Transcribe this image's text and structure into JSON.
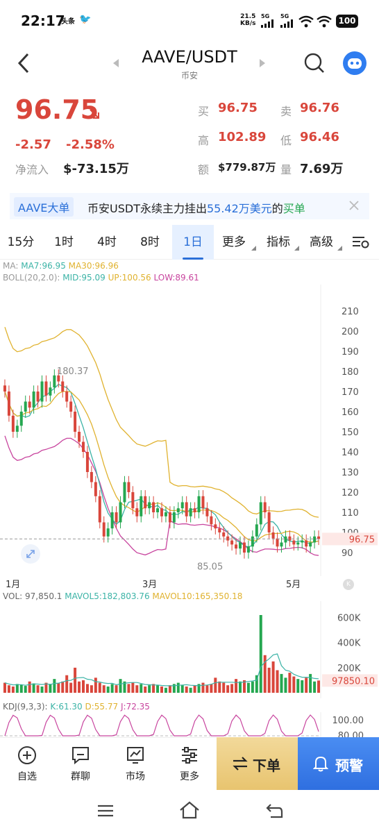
{
  "status_bar": {
    "time": "22:17",
    "app_icons": "头条",
    "net_speed_top": "21.5",
    "net_speed_bottom": "KB/s",
    "sig1": "5G",
    "sig2": "5G",
    "battery": "100"
  },
  "header": {
    "title": "AAVE/USDT",
    "subtitle": "币安"
  },
  "ticker": {
    "price": "96.75",
    "change": "-2.57",
    "change_pct": "-2.58%",
    "netflow_label": "净流入",
    "netflow": "$-73.15万",
    "bid_label": "买",
    "bid": "96.75",
    "ask_label": "卖",
    "ask": "96.76",
    "high_label": "高",
    "high": "102.89",
    "low_label": "低",
    "low": "96.46",
    "amount_label": "额",
    "amount": "$779.87万",
    "volume_label": "量",
    "volume": "7.69万"
  },
  "banner": {
    "tag": "AAVE大单",
    "text1": "币安USDT永续主力挂出",
    "amount": "55.42万美元",
    "text2": "的",
    "side": "买单"
  },
  "tabs": [
    {
      "label": "15分"
    },
    {
      "label": "1时"
    },
    {
      "label": "4时"
    },
    {
      "label": "8时"
    },
    {
      "label": "1日"
    },
    {
      "label": "更多"
    },
    {
      "label": "指标"
    },
    {
      "label": "高级"
    }
  ],
  "indicators": {
    "ma_label": "MA:",
    "ma7": "MA7:96.95",
    "ma30": "MA30:96.96",
    "boll_label": "BOLL(20,2.0):",
    "boll_mid": "MID:95.09",
    "boll_up": "UP:100.56",
    "boll_low": "LOW:89.61",
    "vol_label": "VOL: 97,850.1",
    "mavol5": "MAVOL5:182,803.76",
    "mavol10": "MAVOL10:165,350.18",
    "kdj_label": "KDJ(9,3,3):",
    "kdj_k": "K:61.30",
    "kdj_d": "D:55.77",
    "kdj_j": "J:72.35"
  },
  "chart_data": {
    "type": "candlestick",
    "price_axis": [
      "210",
      "200",
      "190",
      "180",
      "170",
      "160",
      "150",
      "140",
      "130",
      "120",
      "110",
      "100",
      "90"
    ],
    "current_price": "96.75",
    "max_label": "180.37",
    "min_label": "85.05",
    "x_labels": [
      "1月",
      "3月",
      "5月"
    ],
    "vol_axis": [
      "600K",
      "400K",
      "200K"
    ],
    "vol_current": "97850.10",
    "kdj_axis": [
      "100.00",
      "80.00"
    ],
    "close": [
      170,
      158,
      150,
      153,
      160,
      165,
      162,
      170,
      165,
      175,
      168,
      172,
      178,
      175,
      170,
      165,
      160,
      150,
      145,
      140,
      130,
      125,
      118,
      105,
      98,
      102,
      110,
      105,
      115,
      125,
      120,
      112,
      108,
      118,
      112,
      115,
      110,
      112,
      108,
      110,
      105,
      110,
      112,
      115,
      108,
      112,
      110,
      118,
      112,
      108,
      104,
      102,
      100,
      98,
      96,
      94,
      92,
      95,
      90,
      93,
      98,
      104,
      115,
      110,
      100,
      97,
      93,
      95,
      98,
      96,
      94,
      95,
      96,
      93,
      95,
      98,
      96.75
    ],
    "volume_k": [
      80,
      60,
      50,
      70,
      65,
      55,
      90,
      75,
      60,
      50,
      80,
      70,
      110,
      75,
      90,
      140,
      80,
      200,
      90,
      100,
      70,
      60,
      120,
      80,
      60,
      50,
      70,
      60,
      110,
      90,
      70,
      80,
      60,
      70,
      50,
      60,
      70,
      60,
      50,
      40,
      60,
      70,
      80,
      60,
      50,
      40,
      60,
      70,
      80,
      60,
      70,
      120,
      90,
      80,
      60,
      70,
      110,
      90,
      100,
      80,
      90,
      140,
      620,
      300,
      200,
      250,
      180,
      150,
      120,
      160,
      130,
      110,
      100,
      120,
      150,
      90,
      97.85
    ]
  },
  "bottom_nav": [
    {
      "label": "自选",
      "icon": "plus-circle-icon"
    },
    {
      "label": "群聊",
      "icon": "chat-icon"
    },
    {
      "label": "市场",
      "icon": "market-chart-icon"
    },
    {
      "label": "更多",
      "icon": "sliders-icon"
    }
  ],
  "order_button": "下单",
  "alert_button": "预警"
}
